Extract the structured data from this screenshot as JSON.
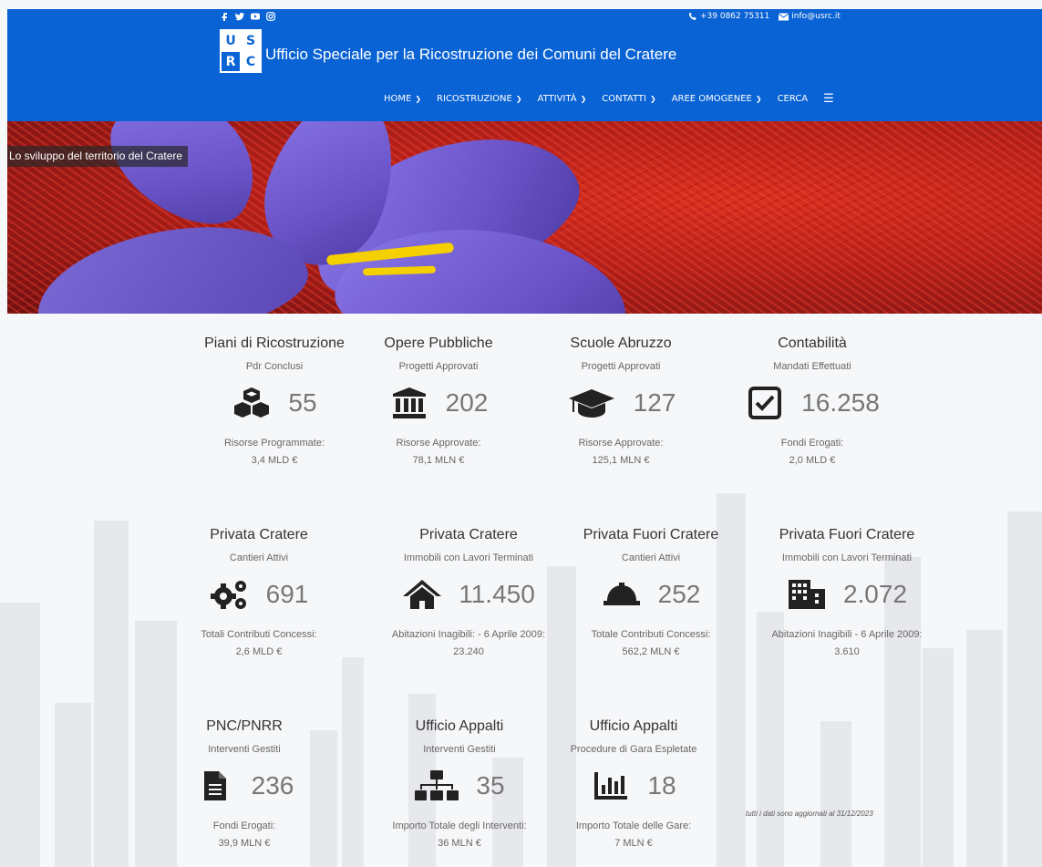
{
  "header": {
    "phone": "+39 0862 75311",
    "email": "info@usrc.it",
    "logo_letters": [
      "U",
      "S",
      "R",
      "C"
    ],
    "site_title": "Ufficio Speciale per la Ricostruzione dei Comuni del Cratere",
    "social_icons": [
      "facebook-icon",
      "twitter-icon",
      "youtube-icon",
      "instagram-icon"
    ],
    "nav": [
      {
        "label": "HOME"
      },
      {
        "label": "RICOSTRUZIONE"
      },
      {
        "label": "ATTIVITÀ"
      },
      {
        "label": "CONTATTI"
      },
      {
        "label": "AREE OMOGENEE"
      },
      {
        "label": "CERCA"
      }
    ],
    "accent": "#0a63d4"
  },
  "hero": {
    "caption": "Lo sviluppo del territorio del Cratere"
  },
  "stats": [
    {
      "title": "Piani di Ricostruzione",
      "sub": "Pdr Conclusi",
      "icon": "cubes-icon",
      "value": "55",
      "foot1": "Risorse Programmate:",
      "foot2": "3,4 MLD €"
    },
    {
      "title": "Opere Pubbliche",
      "sub": "Progetti Approvati",
      "icon": "bank-icon",
      "value": "202",
      "foot1": "Risorse Approvate:",
      "foot2": "78,1 MLN €"
    },
    {
      "title": "Scuole Abruzzo",
      "sub": "Progetti Approvati",
      "icon": "graduation-cap-icon",
      "value": "127",
      "foot1": "Risorse Approvate:",
      "foot2": "125,1 MLN €"
    },
    {
      "title": "Contabilità",
      "sub": "Mandati Effettuati",
      "icon": "check-square-icon",
      "value": "16.258",
      "foot1": "Fondi Erogati:",
      "foot2": "2,0 MLD €"
    },
    {
      "title": "Privata Cratere",
      "sub": "Cantieri Attivi",
      "icon": "cogs-icon",
      "value": "691",
      "foot1": "Totali Contributi Concessi:",
      "foot2": "2,6 MLD €"
    },
    {
      "title": "Privata Cratere",
      "sub": "Immobili con Lavori Terminati",
      "icon": "home-icon",
      "value": "11.450",
      "foot1": "Abitazioni Inagibili: - 6 Aprile 2009:",
      "foot2": "23.240"
    },
    {
      "title": "Privata Fuori Cratere",
      "sub": "Cantieri Attivi",
      "icon": "hard-hat-icon",
      "value": "252",
      "foot1": "Totale Contributi Concessi:",
      "foot2": "562,2 MLN €"
    },
    {
      "title": "Privata Fuori Cratere",
      "sub": "Immobili con Lavori Terminati",
      "icon": "building-icon",
      "value": "2.072",
      "foot1": "Abitazioni Inagibili - 6 Aprile 2009:",
      "foot2": "3.610"
    },
    {
      "title": "PNC/PNRR",
      "sub": "Interventi Gestiti",
      "icon": "file-icon",
      "value": "236",
      "foot1": "Fondi Erogati:",
      "foot2": "39,9 MLN €"
    },
    {
      "title": "Ufficio Appalti",
      "sub": "Interventi Gestiti",
      "icon": "sitemap-icon",
      "value": "35",
      "foot1": "Importo Totale degli Interventi:",
      "foot2": "36 MLN €"
    },
    {
      "title": "Ufficio Appalti",
      "sub": "Procedure di Gara Espletate",
      "icon": "bar-chart-icon",
      "value": "18",
      "foot1": "Importo Totale delle Gare:",
      "foot2": "7 MLN €"
    }
  ],
  "note": "tutti i dati sono aggiornati al 31/12/2023"
}
